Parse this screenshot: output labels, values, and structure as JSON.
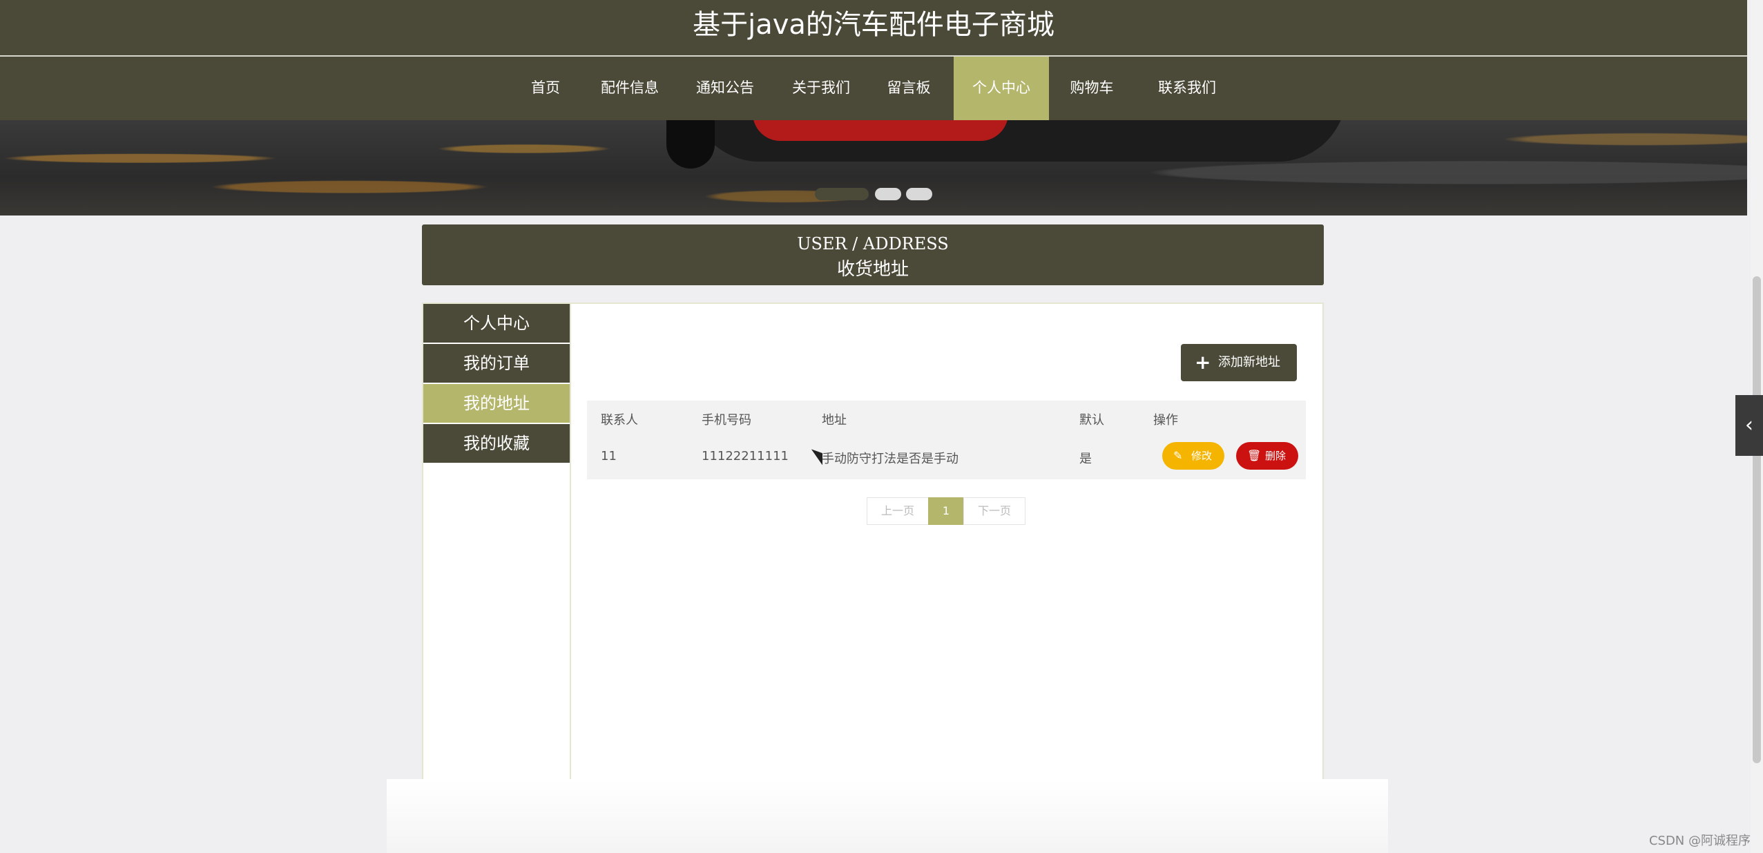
{
  "site": {
    "title": "基于java的汽车配件电子商城"
  },
  "nav": {
    "items": [
      {
        "label": "首页"
      },
      {
        "label": "配件信息"
      },
      {
        "label": "通知公告"
      },
      {
        "label": "关于我们"
      },
      {
        "label": "留言板"
      },
      {
        "label": "个人中心"
      },
      {
        "label": "购物车"
      },
      {
        "label": "联系我们"
      }
    ],
    "active": "个人中心"
  },
  "banner": {
    "slide_count": 3,
    "active_slide": 1
  },
  "page": {
    "heading_en": "USER / ADDRESS",
    "heading_zh": "收货地址"
  },
  "sidebar": {
    "items": [
      {
        "label": "个人中心"
      },
      {
        "label": "我的订单"
      },
      {
        "label": "我的地址"
      },
      {
        "label": "我的收藏"
      }
    ],
    "active": "我的地址"
  },
  "actions": {
    "add_label": "添加新地址"
  },
  "table": {
    "headers": [
      "联系人",
      "手机号码",
      "地址",
      "默认",
      "操作"
    ],
    "rows": [
      {
        "contact": "11",
        "phone": "11122211111",
        "address": "手动防守打法是否是手动",
        "is_default": "是",
        "edit_label": "修改",
        "delete_label": "删除"
      }
    ]
  },
  "pager": {
    "prev": "上一页",
    "current": "1",
    "next": "下一页"
  },
  "watermark": "CSDN @阿诚程序",
  "colors": {
    "brand_dark": "#4b4a38",
    "accent": "#b4b66c",
    "edit": "#f5b400",
    "delete": "#cc1111"
  }
}
